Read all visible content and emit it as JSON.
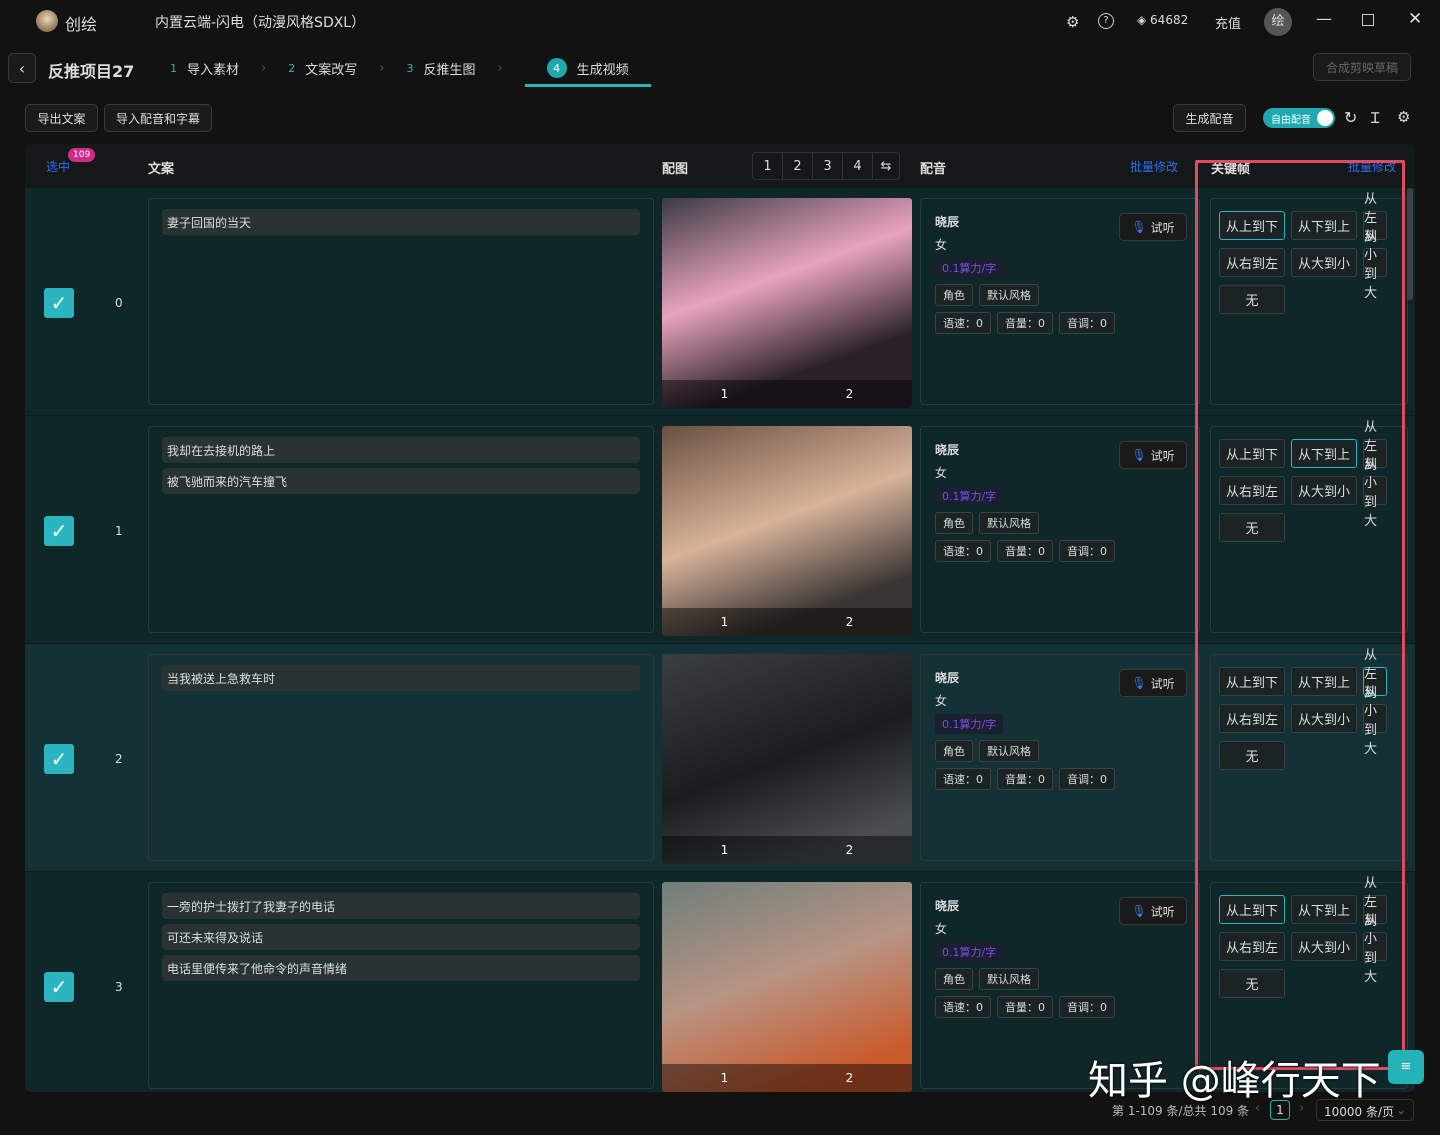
{
  "app": {
    "name": "创绘",
    "title": "内置云端-闪电（动漫风格SDXL）",
    "credits": "64682",
    "recharge": "充值",
    "avatar": "绘"
  },
  "project": {
    "title": "反推项目27",
    "steps": [
      {
        "num": "1",
        "label": "导入素材"
      },
      {
        "num": "2",
        "label": "文案改写"
      },
      {
        "num": "3",
        "label": "反推生图"
      },
      {
        "num": "4",
        "label": "生成视频"
      }
    ],
    "compose": "合成剪映草稿"
  },
  "toolbar": {
    "export": "导出文案",
    "import": "导入配音和字幕",
    "gen_voice": "生成配音",
    "free_voice": "自由配音"
  },
  "header": {
    "select": "选中",
    "count": "109",
    "text": "文案",
    "image": "配图",
    "pages": [
      "1",
      "2",
      "3",
      "4"
    ],
    "voice": "配音",
    "batch": "批量修改",
    "keyframe": "关键帧",
    "batch2": "批量修改"
  },
  "voice": {
    "name": "晓辰",
    "gender": "女",
    "price": "0.1算力/字",
    "role": "角色",
    "style": "默认风格",
    "speed": "语速：0",
    "volume": "音量：0",
    "pitch": "音调：0",
    "listen": "试听"
  },
  "keyframes": [
    "从上到下",
    "从下到上",
    "从左到右",
    "从右到左",
    "从大到小",
    "从小到大",
    "无"
  ],
  "rows": [
    {
      "index": "0",
      "lines": [
        "妻子回国的当天"
      ],
      "selected": 0
    },
    {
      "index": "1",
      "lines": [
        "我却在去接机的路上",
        "被飞驰而来的汽车撞飞"
      ],
      "selected": 1
    },
    {
      "index": "2",
      "lines": [
        "当我被送上急救车时"
      ],
      "selected": 2
    },
    {
      "index": "3",
      "lines": [
        "一旁的护士拨打了我妻子的电话",
        "可还未来得及说话",
        "电话里便传来了他命令的声音情绪"
      ],
      "selected": 0
    }
  ],
  "image_pages": [
    "1",
    "2"
  ],
  "footer": {
    "summary": "第 1-109 条/总共 109 条",
    "page": "1",
    "per_page": "10000 条/页"
  },
  "watermark": "知乎 @峰行天下"
}
